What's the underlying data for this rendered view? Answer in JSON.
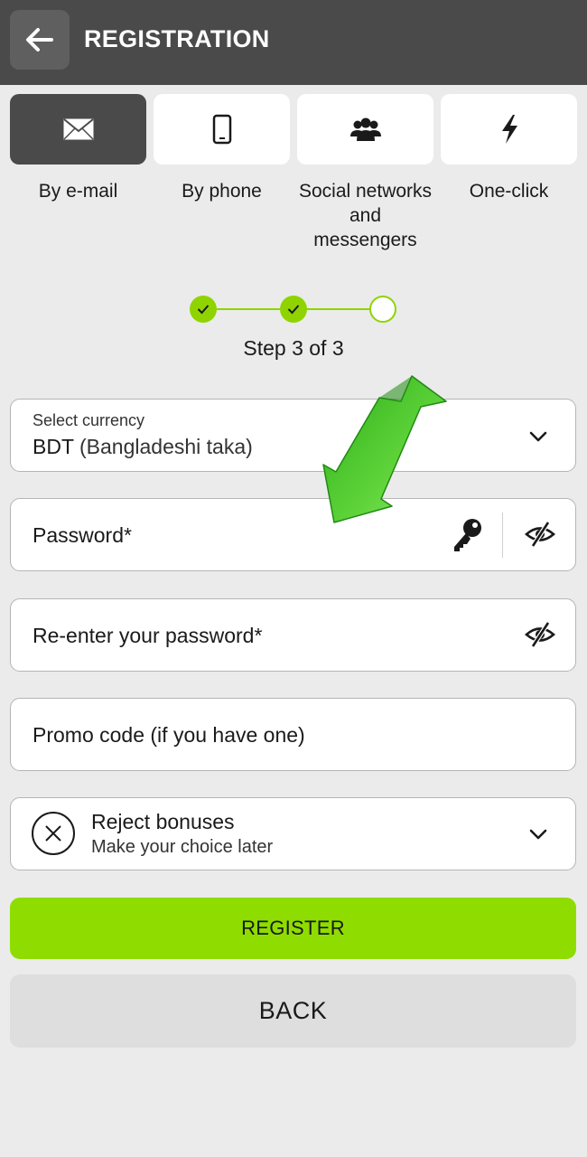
{
  "header": {
    "title": "REGISTRATION",
    "back_icon": "arrow-left-icon"
  },
  "methods": [
    {
      "label": "By e-mail",
      "icon": "envelope-icon",
      "active": true
    },
    {
      "label": "By phone",
      "icon": "phone-icon",
      "active": false
    },
    {
      "label": "Social networks and messengers",
      "icon": "users-icon",
      "active": false
    },
    {
      "label": "One-click",
      "icon": "lightning-icon",
      "active": false
    }
  ],
  "stepper": {
    "current_step": 3,
    "total_steps": 3,
    "text": "Step 3 of 3"
  },
  "form": {
    "currency": {
      "label": "Select currency",
      "code": "BDT",
      "name": "(Bangladeshi taka)"
    },
    "password": {
      "placeholder": "Password*"
    },
    "repassword": {
      "placeholder": "Re-enter your password*"
    },
    "promo": {
      "placeholder": "Promo code (if you have one)"
    },
    "bonus": {
      "title": "Reject bonuses",
      "subtitle": "Make your choice later"
    }
  },
  "buttons": {
    "register": "REGISTER",
    "back": "BACK"
  },
  "colors": {
    "header_bg": "#4a4a4a",
    "accent_green": "#8fdd00",
    "page_bg": "#ebebeb"
  }
}
